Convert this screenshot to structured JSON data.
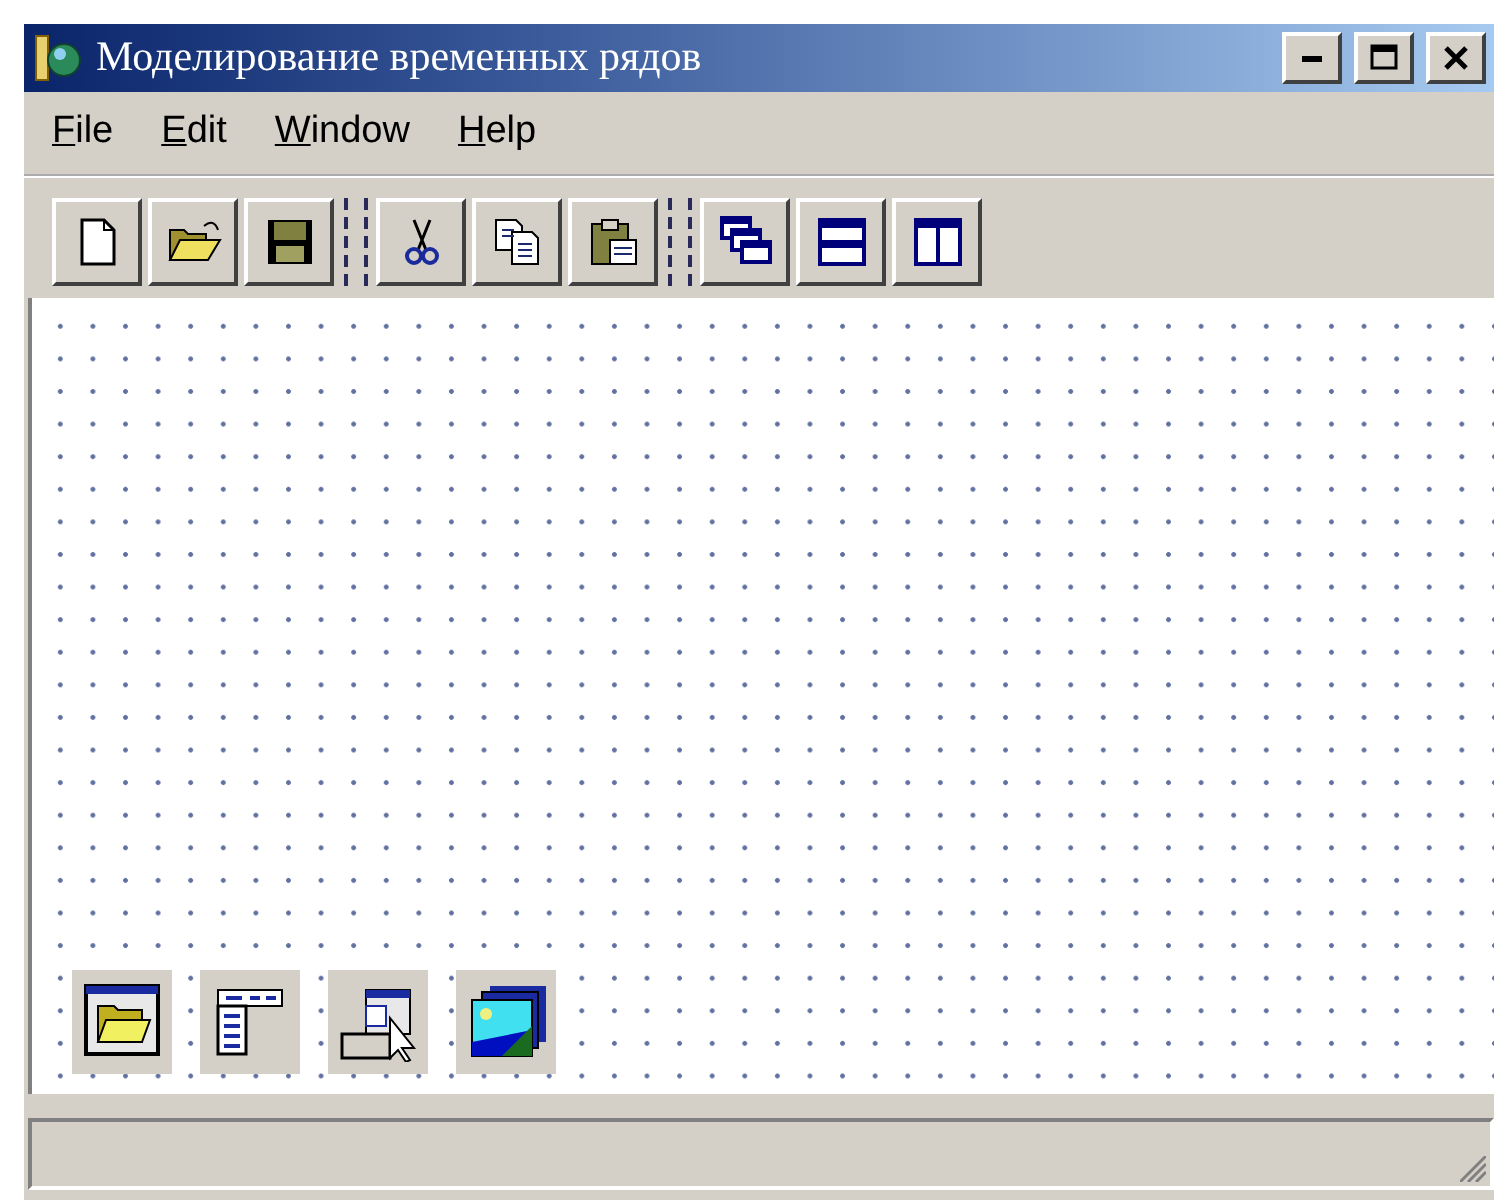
{
  "window": {
    "title": "Моделирование временных рядов"
  },
  "menu": [
    {
      "mnemonic": "F",
      "rest": "ile"
    },
    {
      "mnemonic": "E",
      "rest": "dit"
    },
    {
      "mnemonic": "W",
      "rest": "indow"
    },
    {
      "mnemonic": "H",
      "rest": "elp"
    }
  ],
  "toolbar": [
    {
      "buttons": [
        {
          "kind": "new"
        },
        {
          "kind": "open"
        },
        {
          "kind": "save"
        }
      ]
    },
    {
      "buttons": [
        {
          "kind": "cut"
        },
        {
          "kind": "copy"
        },
        {
          "kind": "paste"
        }
      ]
    },
    {
      "buttons": [
        {
          "kind": "cascade"
        },
        {
          "kind": "tile-horizontal"
        },
        {
          "kind": "tile-vertical"
        }
      ]
    }
  ],
  "palette": [
    {
      "kind": "folder-window"
    },
    {
      "kind": "list-window"
    },
    {
      "kind": "dialog"
    },
    {
      "kind": "images"
    }
  ]
}
